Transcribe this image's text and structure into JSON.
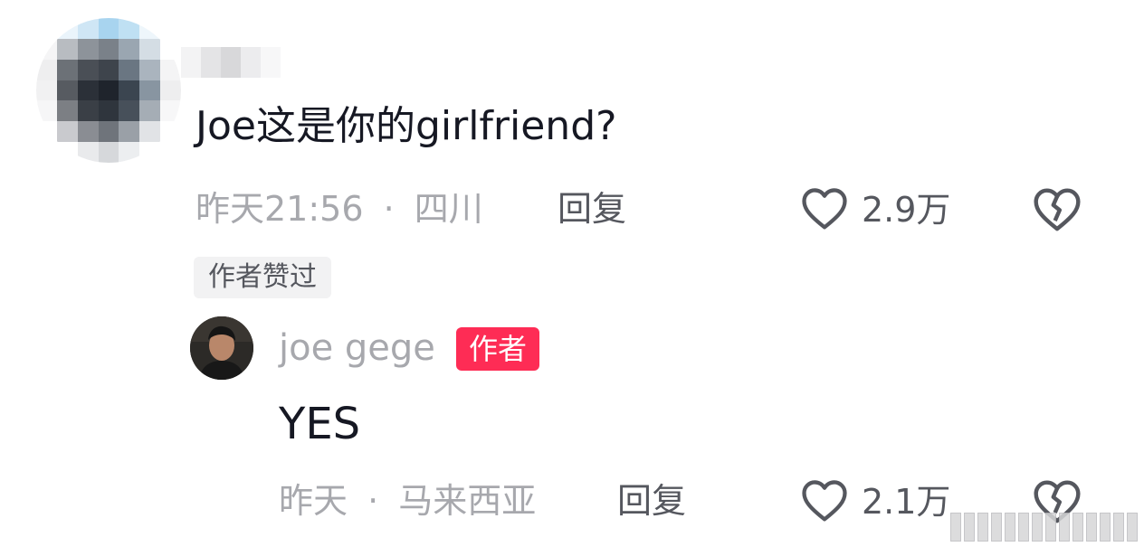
{
  "comment": {
    "text": "Joe这是你的girlfriend?",
    "time": "昨天21:56",
    "separator": "·",
    "location": "四川",
    "reply_label": "回复",
    "like_count": "2.9万",
    "author_liked_badge": "作者赞过"
  },
  "reply": {
    "username": "joe gege",
    "author_badge": "作者",
    "text": "YES",
    "time": "昨天",
    "separator": "·",
    "location": "马来西亚",
    "reply_label": "回复",
    "like_count": "2.1万"
  },
  "colors": {
    "accent_badge": "#fe2c55",
    "primary_text": "#161823",
    "secondary_text": "#a7a8ad",
    "action_text": "#55575e"
  },
  "icons": [
    "heart-outline-icon",
    "broken-heart-icon"
  ]
}
